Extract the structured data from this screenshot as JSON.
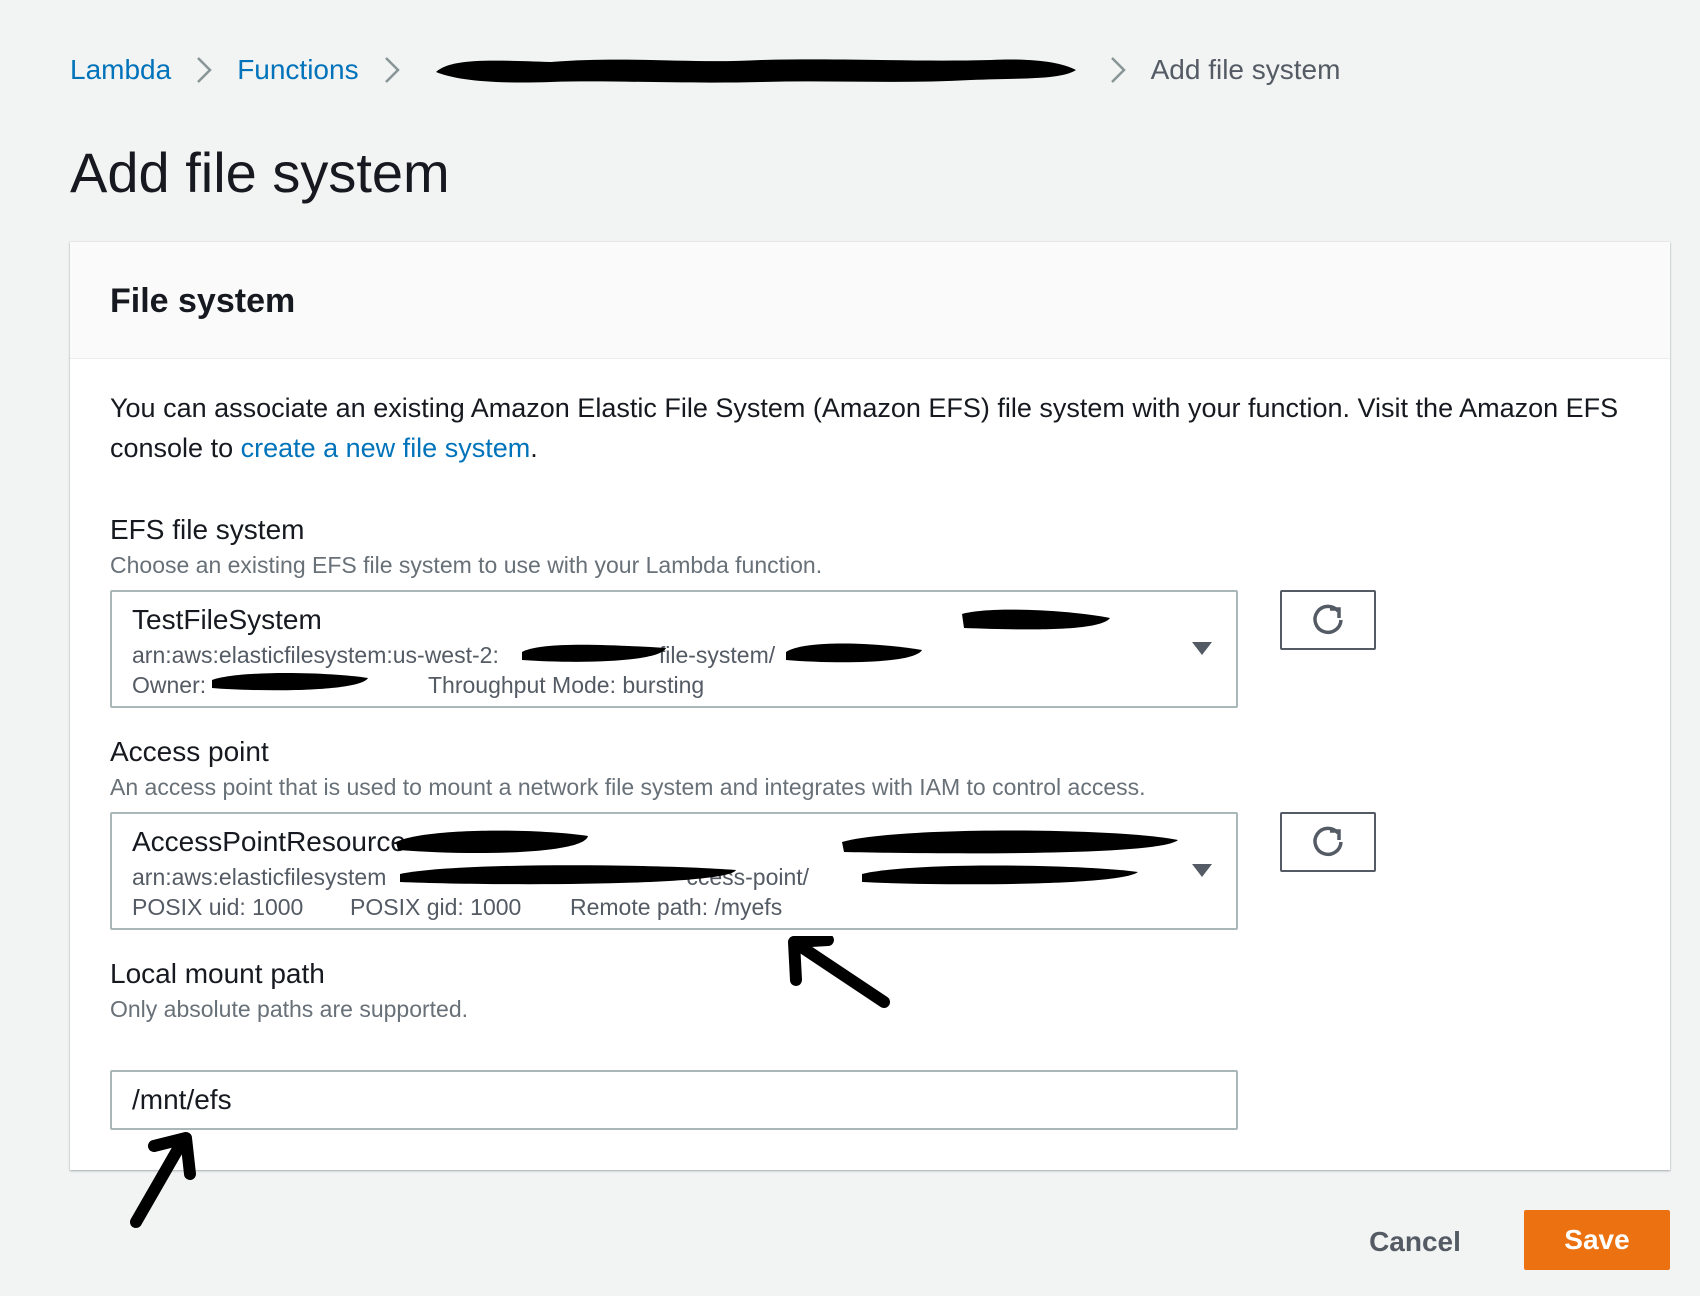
{
  "breadcrumb": {
    "items": [
      "Lambda",
      "Functions"
    ],
    "current": "Add file system"
  },
  "page": {
    "title": "Add file system"
  },
  "panel": {
    "title": "File system",
    "description_prefix": "You can associate an existing Amazon Elastic File System (Amazon EFS) file system with your function. Visit the Amazon EFS console to ",
    "description_link": "create a new file system",
    "description_suffix": "."
  },
  "efs": {
    "label": "EFS file system",
    "hint": "Choose an existing EFS file system to use with your Lambda function.",
    "selected": {
      "name": "TestFileSystem",
      "arn_prefix": "arn:aws:elasticfilesystem:us-west-2:",
      "arn_mid": "file-system/",
      "owner_label": "Owner:",
      "throughput": "Throughput Mode: bursting"
    }
  },
  "access_point": {
    "label": "Access point",
    "hint": "An access point that is used to mount a network file system and integrates with IAM to control access.",
    "selected": {
      "name": "AccessPointResource",
      "arn_prefix": "arn:aws:elasticfilesystem",
      "arn_mid": "ccess-point/",
      "posix_uid": "POSIX uid: 1000",
      "posix_gid": "POSIX gid: 1000",
      "remote_path": "Remote path: /myefs"
    }
  },
  "mount": {
    "label": "Local mount path",
    "hint": "Only absolute paths are supported.",
    "value": "/mnt/efs"
  },
  "footer": {
    "cancel": "Cancel",
    "save": "Save"
  },
  "colors": {
    "accent": "#ec7211",
    "link": "#0073bb",
    "background": "#f2f3f3",
    "redaction": "#000000"
  },
  "icons": [
    "chevron-right-icon",
    "refresh-icon",
    "caret-down-icon",
    "arrow-annotation"
  ]
}
